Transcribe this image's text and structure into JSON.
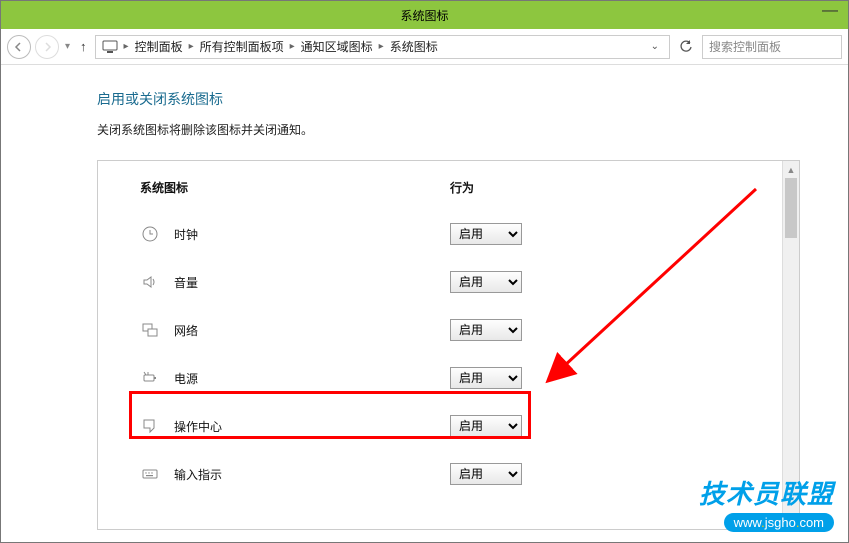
{
  "window": {
    "title": "系统图标"
  },
  "nav": {
    "breadcrumbs": [
      "控制面板",
      "所有控制面板项",
      "通知区域图标",
      "系统图标"
    ],
    "search_placeholder": "搜索控制面板"
  },
  "page": {
    "heading": "启用或关闭系统图标",
    "subtext": "关闭系统图标将删除该图标并关闭通知。"
  },
  "table": {
    "col1_header": "系统图标",
    "col2_header": "行为",
    "option_enable": "启用",
    "rows": [
      {
        "icon": "clock-icon",
        "label": "时钟",
        "value": "启用"
      },
      {
        "icon": "volume-icon",
        "label": "音量",
        "value": "启用"
      },
      {
        "icon": "network-icon",
        "label": "网络",
        "value": "启用"
      },
      {
        "icon": "power-icon",
        "label": "电源",
        "value": "启用"
      },
      {
        "icon": "action-center-icon",
        "label": "操作中心",
        "value": "启用"
      },
      {
        "icon": "keyboard-icon",
        "label": "输入指示",
        "value": "启用"
      }
    ]
  },
  "watermark": {
    "line1": "技术员联盟",
    "url_pre": "www",
    "url_mid": "jsgho",
    "url_suf": "com"
  }
}
